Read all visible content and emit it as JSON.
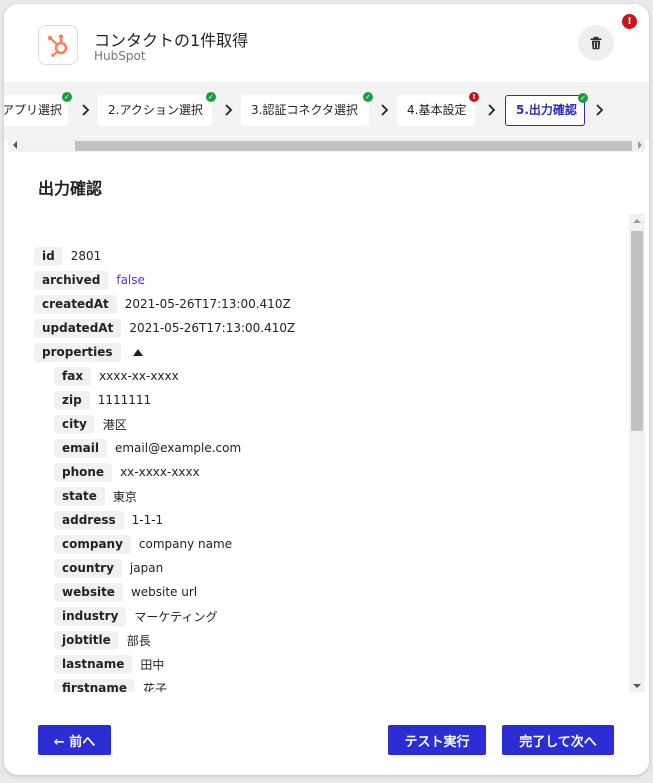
{
  "header": {
    "title": "コンタクトの1件取得",
    "subtitle": "HubSpot",
    "alert": "!"
  },
  "steps": [
    {
      "label": "アプリ選択",
      "status": "ok"
    },
    {
      "label": "2.アクション選択",
      "status": "ok"
    },
    {
      "label": "3.認証コネクタ選択",
      "status": "ok"
    },
    {
      "label": "4.基本設定",
      "status": "error"
    },
    {
      "label": "5.出力確認",
      "status": "ok",
      "active": true
    }
  ],
  "badges": {
    "ok": "✓",
    "error": "!"
  },
  "section": {
    "title": "出力確認"
  },
  "output": {
    "top": [
      {
        "key": "id",
        "value": "2801"
      },
      {
        "key": "archived",
        "value": "false",
        "bool": true
      },
      {
        "key": "createdAt",
        "value": "2021-05-26T17:13:00.410Z"
      },
      {
        "key": "updatedAt",
        "value": "2021-05-26T17:13:00.410Z"
      }
    ],
    "properties_key": "properties",
    "properties": [
      {
        "key": "fax",
        "value": "xxxx-xx-xxxx"
      },
      {
        "key": "zip",
        "value": "1111111"
      },
      {
        "key": "city",
        "value": "港区"
      },
      {
        "key": "email",
        "value": "email@example.com"
      },
      {
        "key": "phone",
        "value": "xx-xxxx-xxxx"
      },
      {
        "key": "state",
        "value": "東京"
      },
      {
        "key": "address",
        "value": "1-1-1"
      },
      {
        "key": "company",
        "value": "company name"
      },
      {
        "key": "country",
        "value": "japan"
      },
      {
        "key": "website",
        "value": "website url"
      },
      {
        "key": "industry",
        "value": "マーケティング"
      },
      {
        "key": "jobtitle",
        "value": "部長"
      },
      {
        "key": "lastname",
        "value": "田中"
      },
      {
        "key": "firstname",
        "value": "花子"
      }
    ]
  },
  "footer": {
    "prev": "← 前へ",
    "test": "テスト実行",
    "next": "完了して次へ"
  },
  "colors": {
    "accent": "#2d2dd6",
    "ok": "#1a9e3a",
    "error": "#c41818",
    "hubspot": "#ff7a59"
  }
}
